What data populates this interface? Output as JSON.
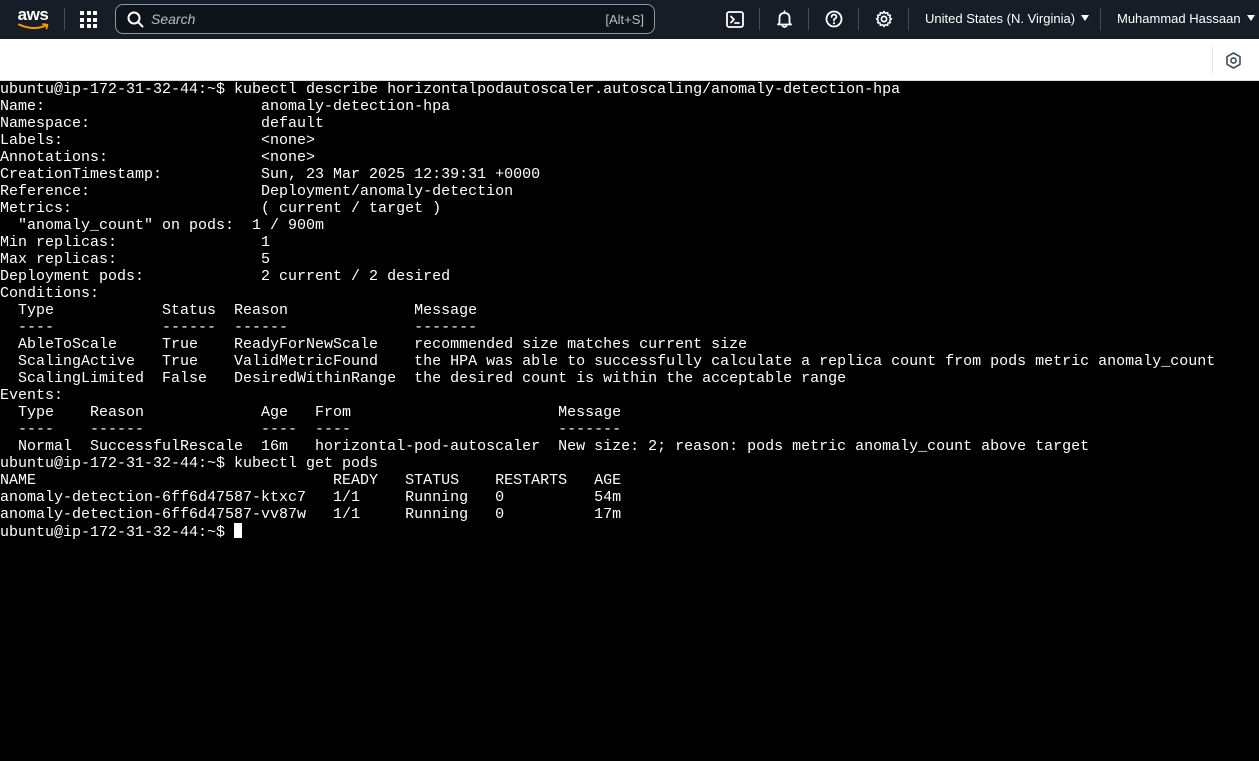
{
  "topbar": {
    "logo_text": "aws",
    "search_placeholder": "Search",
    "search_shortcut": "[Alt+S]",
    "icons": [
      "services-grid-icon",
      "cloudshell-icon",
      "bell-icon",
      "help-icon",
      "gear-icon",
      "cloudshell-panel-icon"
    ],
    "region": "United States (N. Virginia)",
    "user": "Muhammad Hassaan",
    "background": "#161d26"
  },
  "terminal": {
    "lines": [
      "ubuntu@ip-172-31-32-44:~$ kubectl describe horizontalpodautoscaler.autoscaling/anomaly-detection-hpa",
      "Name:                        anomaly-detection-hpa",
      "Namespace:                   default",
      "Labels:                      <none>",
      "Annotations:                 <none>",
      "CreationTimestamp:           Sun, 23 Mar 2025 12:39:31 +0000",
      "Reference:                   Deployment/anomaly-detection",
      "Metrics:                     ( current / target )",
      "  \"anomaly_count\" on pods:  1 / 900m",
      "Min replicas:                1",
      "Max replicas:                5",
      "Deployment pods:             2 current / 2 desired",
      "Conditions:",
      "  Type            Status  Reason              Message",
      "  ----            ------  ------              -------",
      "  AbleToScale     True    ReadyForNewScale    recommended size matches current size",
      "  ScalingActive   True    ValidMetricFound    the HPA was able to successfully calculate a replica count from pods metric anomaly_count",
      "  ScalingLimited  False   DesiredWithinRange  the desired count is within the acceptable range",
      "Events:",
      "  Type    Reason             Age   From                       Message",
      "  ----    ------             ----  ----                       -------",
      "  Normal  SuccessfulRescale  16m   horizontal-pod-autoscaler  New size: 2; reason: pods metric anomaly_count above target",
      "ubuntu@ip-172-31-32-44:~$ kubectl get pods",
      "NAME                                 READY   STATUS    RESTARTS   AGE",
      "anomaly-detection-6ff6d47587-ktxc7   1/1     Running   0          54m",
      "anomaly-detection-6ff6d47587-vv87w   1/1     Running   0          17m"
    ],
    "prompt": "ubuntu@ip-172-31-32-44:~$ "
  }
}
